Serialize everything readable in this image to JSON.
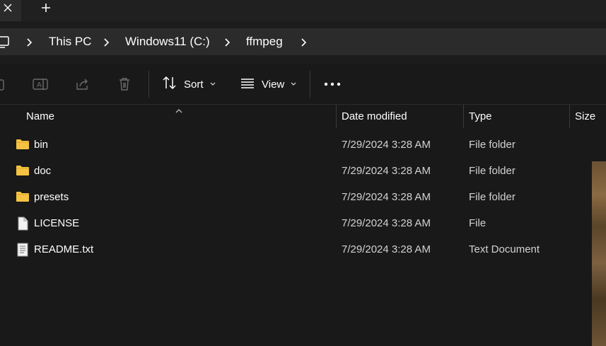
{
  "titlebar": {
    "close_icon": "close-icon",
    "new_tab_icon": "plus-icon"
  },
  "address": {
    "crumbs": [
      "This PC",
      "Windows11 (C:)",
      "ffmpeg"
    ]
  },
  "toolbar": {
    "sort_label": "Sort",
    "view_label": "View",
    "more_icon": "more-dots-icon"
  },
  "columns": {
    "name": "Name",
    "date": "Date modified",
    "type": "Type",
    "size": "Size"
  },
  "files": [
    {
      "name": "bin",
      "date": "7/29/2024 3:28 AM",
      "type": "File folder",
      "icon": "folder-icon"
    },
    {
      "name": "doc",
      "date": "7/29/2024 3:28 AM",
      "type": "File folder",
      "icon": "folder-icon"
    },
    {
      "name": "presets",
      "date": "7/29/2024 3:28 AM",
      "type": "File folder",
      "icon": "folder-icon"
    },
    {
      "name": "LICENSE",
      "date": "7/29/2024 3:28 AM",
      "type": "File",
      "icon": "file-icon"
    },
    {
      "name": "README.txt",
      "date": "7/29/2024 3:28 AM",
      "type": "Text Document",
      "icon": "text-file-icon"
    }
  ],
  "colors": {
    "background": "#191919",
    "address_bar": "#2b2b2b",
    "folder": "#f5c342"
  }
}
